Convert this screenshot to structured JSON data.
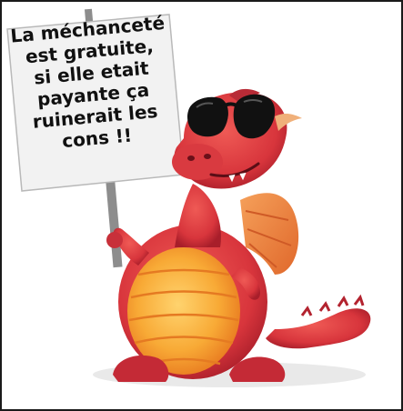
{
  "sign": {
    "lines": [
      "La méchanceté",
      "est gratuite,",
      "si elle etait",
      "payante ça",
      "ruinerait les",
      "cons !!"
    ]
  },
  "illustration": {
    "subject-icon": "cartoon-dragon-icon",
    "accessory-icon": "sunglasses-icon",
    "prop-icon": "picket-sign-icon"
  },
  "colors": {
    "background": "#ffffff",
    "border": "#1a1a1a",
    "dragon_body": "#d8353c",
    "dragon_belly": "#f6a02f",
    "wing": "#f08a3c",
    "sign_board": "#f2f2f2",
    "pole": "#8d8d8d",
    "text": "#111111"
  }
}
